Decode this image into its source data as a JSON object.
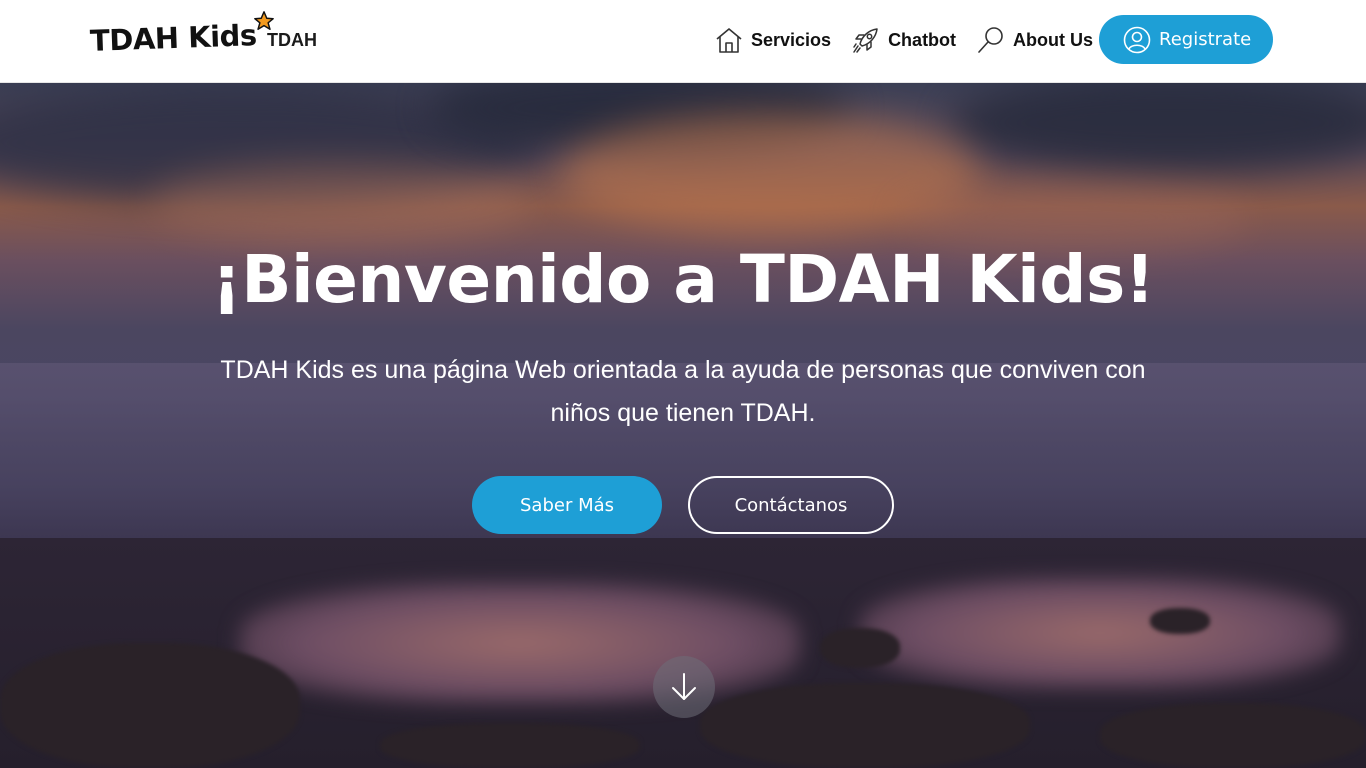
{
  "header": {
    "logo_text": "TDAH Kids",
    "brand_sub": "TDAH",
    "nav": [
      {
        "label": "Servicios",
        "icon": "home-icon"
      },
      {
        "label": "Chatbot",
        "icon": "rocket-icon"
      },
      {
        "label": "About Us",
        "icon": "search-icon"
      }
    ],
    "register_label": "Registrate"
  },
  "hero": {
    "title": "¡Bienvenido a TDAH Kids!",
    "description": "TDAH Kids es una página Web orientada a la ayuda de personas que conviven con niños que tienen TDAH.",
    "primary_button": "Saber Más",
    "secondary_button": "Contáctanos",
    "scroll_icon": "arrow-down-icon"
  },
  "colors": {
    "accent": "#1e9fd6",
    "header_bg": "#ffffff",
    "text_light": "#ffffff"
  }
}
